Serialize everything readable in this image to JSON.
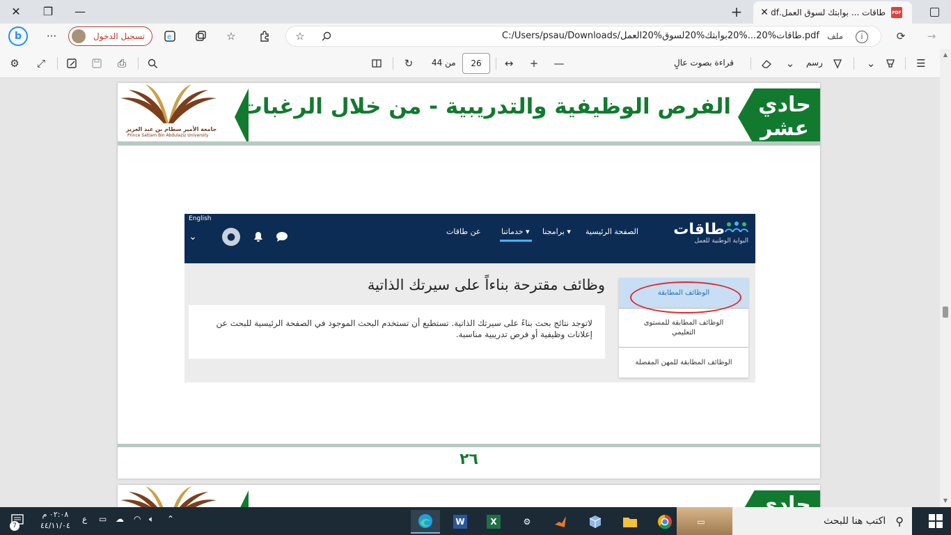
{
  "browser": {
    "tab_title": "طاقات ... بوابتك لسوق العمل.pdf",
    "tab_close": "✕",
    "new_tab": "+",
    "win_close": "✕",
    "win_restore": "❐",
    "win_minimize": "—",
    "url": "C:/Users/psau/Downloads/طاقات%20...%20بوابتك%20لسوق%20العمل.pdf",
    "file_label": "ملف",
    "sign_in_label": "تسجيل الدخول",
    "more_label": "···"
  },
  "pdf_toolbar": {
    "read_aloud": "قراءة بصوت عالٍ",
    "draw": "رسم",
    "page_current": "26",
    "page_of": "من 44",
    "zoom_in": "+",
    "zoom_out": "—"
  },
  "page": {
    "banner_title": "الفرص الوظيفية والتدريبية - من خلال الرغبات",
    "banner_step_line1": "حادي",
    "banner_step_line2": "عشر",
    "logo_ar": "جامعة الأمير سطام بن عبد العزيز",
    "logo_en": "Prince Sattam Bin Abdulaziz University",
    "page_number": "٢٦",
    "next_banner_step": "حادي"
  },
  "shot": {
    "logo_main": "طاقات",
    "logo_sub": "البوابة الوطنية للعمل",
    "nav_home": "الصفحة الرئيسية",
    "nav_programs": "برامجنا",
    "nav_services": "خدماتنا",
    "nav_about": "عن طاقات",
    "lang": "English",
    "heading": "وظائف مقترحة بناءاً على سيرتك الذاتية",
    "message": "لاتوجد نتائج بحث بناءً على سيرتك الذاتية. تستطيع أن تستخدم البحث الموجود في الصفحة الرئيسية للبحث عن إعلانات وظيفية أو فرص تدريبية مناسبة.",
    "side_items": [
      "الوظائف المطابقة",
      "الوظائف المطابقة للمستوى التعليمي",
      "الوظائف المطابقة للمهن المفضلة"
    ]
  },
  "taskbar": {
    "search_placeholder": "اكتب هنا للبحث",
    "time": "٠٢:٠٨ م",
    "date": "٤٤/١١/٠٤",
    "lang_indicator": "ع",
    "notif_count": "7"
  },
  "colors": {
    "banner_green": "#127a2f",
    "nav_navy": "#0d2c54",
    "highlight_red": "#e0262d",
    "active_side": "#c7def4"
  }
}
